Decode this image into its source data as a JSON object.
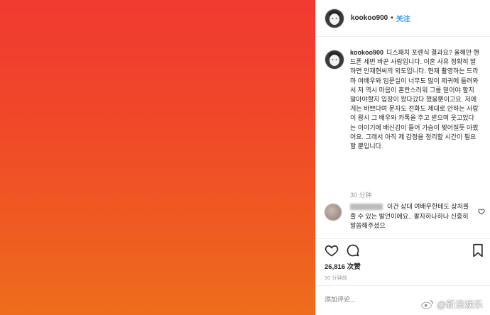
{
  "colors": {
    "photo_top": "#f13a30",
    "photo_bottom": "#ee6d1c",
    "link_blue": "#3897f0",
    "muted": "#999999"
  },
  "header": {
    "username": "kookoo900",
    "separator": "•",
    "follow_label": "关注",
    "avatar_icon": "profile-avatar-icon"
  },
  "caption": {
    "username": "kookoo900",
    "text": "디스패치 포렌식 결과요? 올해만 핸드폰 세번 바꾼 사람입니다. 이혼 사유 정확히 말하면 안재현씨의 외도입니다. 현재 촬영하는 드라마 여배우와 임문실이 너무도 많이 제귀에 들려와서 저 역시 마음이 혼란스러워 그를 믿어야 할지 말아야할지 입장이 왔다갔다 했을뿐이고요. 저에게는 바쁘다며 문자도 전화도 제대로 안하는 사람이 왕시 그 배우와 카톡을 주고 받으며 웃고있다는 이야기에 배신감이 들어 가슴이 찢어질듯 아팠어요. 그래서 아직 제 감정을 정리할 시간이 필요할 뿐입니다.",
    "time": "30 分钟"
  },
  "comment": {
    "text": "이건 상대 여배우한테도 상처를 줄 수 있는 발언이에요.. 팔자하나하나 신중히 말씀해주셨으",
    "like_icon": "heart-outline-icon"
  },
  "actions": {
    "like_icon": "heart-icon",
    "comment_icon": "comment-icon",
    "bookmark_icon": "bookmark-icon"
  },
  "likes": {
    "count": "26,816",
    "label": "次赞"
  },
  "post_time": "30 分钟前",
  "add_comment": {
    "placeholder": "添加评论..."
  },
  "watermark": {
    "text": "@新浪娱乐",
    "icon": "weibo-logo-icon"
  }
}
